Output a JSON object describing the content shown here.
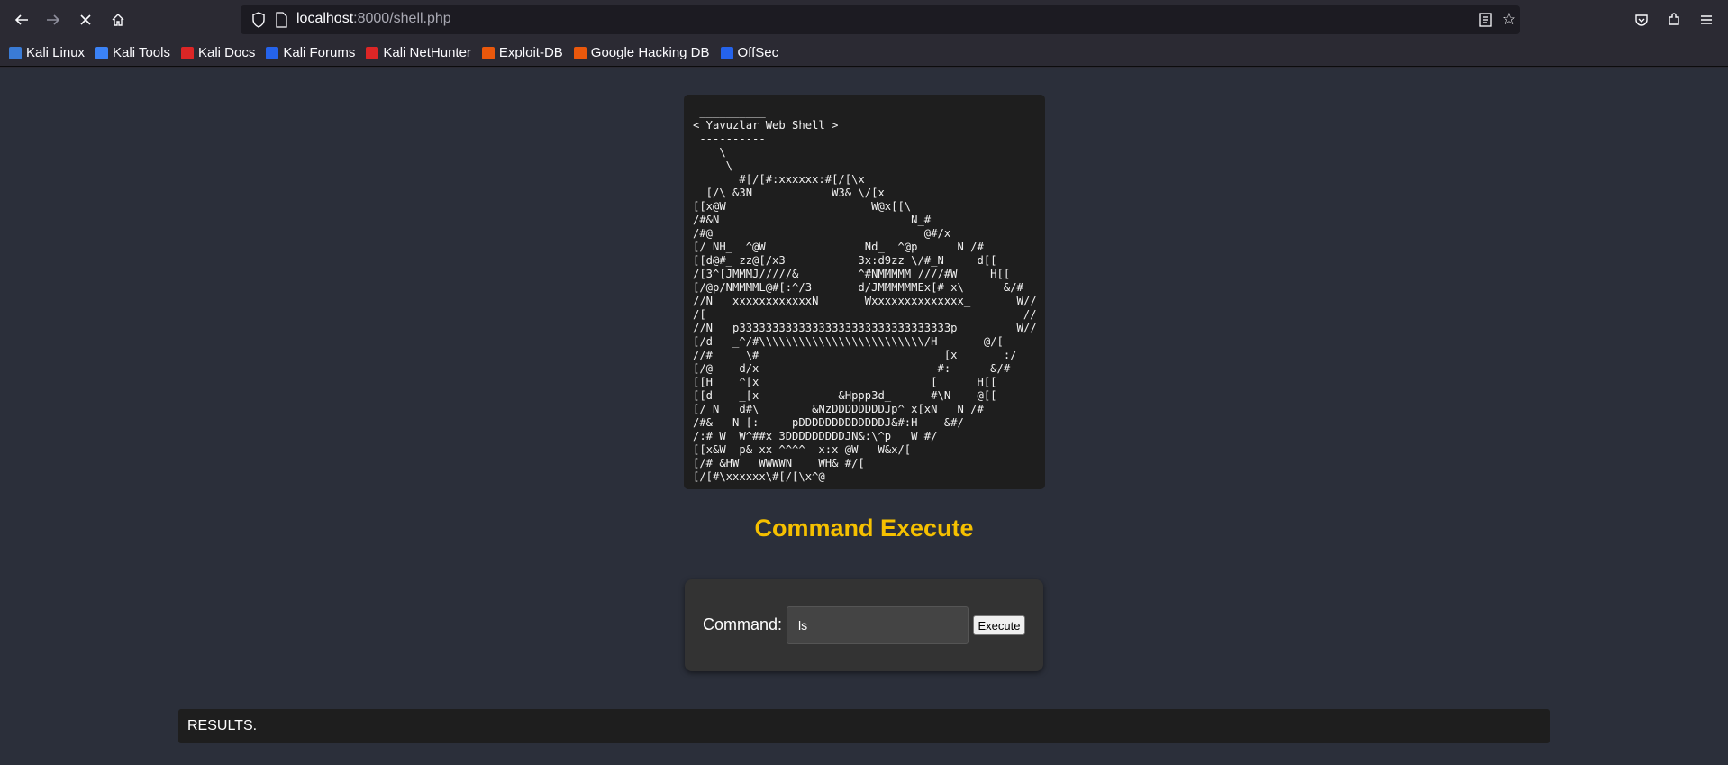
{
  "browser": {
    "url_host": "localhost",
    "url_path": ":8000/shell.php"
  },
  "bookmarks": [
    {
      "label": "Kali Linux",
      "icon": "kali-dragon-icon",
      "color": "#3a7bd5"
    },
    {
      "label": "Kali Tools",
      "icon": "kali-tools-icon",
      "color": "#3b82f6"
    },
    {
      "label": "Kali Docs",
      "icon": "kali-docs-icon",
      "color": "#dc2626"
    },
    {
      "label": "Kali Forums",
      "icon": "kali-forums-icon",
      "color": "#2563eb"
    },
    {
      "label": "Kali NetHunter",
      "icon": "kali-nethunter-icon",
      "color": "#dc2626"
    },
    {
      "label": "Exploit-DB",
      "icon": "exploit-db-icon",
      "color": "#ea580c"
    },
    {
      "label": "Google Hacking DB",
      "icon": "ghdb-icon",
      "color": "#ea580c"
    },
    {
      "label": "OffSec",
      "icon": "offsec-icon",
      "color": "#2563eb"
    }
  ],
  "page": {
    "ascii_art": " __________\n< Yavuzlar Web Shell >\n ----------\n    \\\n     \\\n       #[/[#:xxxxxx:#[/[\\x\n  [/\\ &3N            W3& \\/[x\n[[x@W                      W@x[[\\\n/#&N                             N_#\n/#@                                @#/x\n[/ NH_  ^@W               Nd_  ^@p      N /#\n[[d@#_ zz@[/x3           3x:d9zz \\/#_N     d[[\n/[3^[JMMMJ/////&         ^#NMMMMM ////#W     H[[\n[/@p/NMMMML@#[:^/3       d/JMMMMMMEx[# x\\      &/#\n//N   xxxxxxxxxxxxN       Wxxxxxxxxxxxxxx_       W//\n/[                                                //\n//N   p33333333333333333333333333333333p         W//\n[/d   _^/#\\\\\\\\\\\\\\\\\\\\\\\\\\\\\\\\\\\\\\\\\\\\\\\\\\/H       @/[\n//#     \\#                            [x       :/\n[/@    d/x                           #:      &/#\n[[H    ^[x                          [      H[[\n[[d    _[x            &Hppp3d_      #\\N    @[[\n[/ N   d#\\        &NzDDDDDDDDJp^ x[xN   N /#\n/#&   N [:     pDDDDDDDDDDDDDJ&#:H    &#/\n/:#_W  W^##x 3DDDDDDDDDJN&:\\^p   W_#/\n[[x&W  p& xx ^^^^  x:x @W   W&x/[\n[/# &HW   WWWWN    WH& #/[\n[/[#\\xxxxxx\\#[/[\\x^@",
    "title": "Command Execute",
    "command_label": "Command:",
    "command_value": "ls",
    "execute_label": "Execute",
    "results_text": "RESULTS."
  }
}
